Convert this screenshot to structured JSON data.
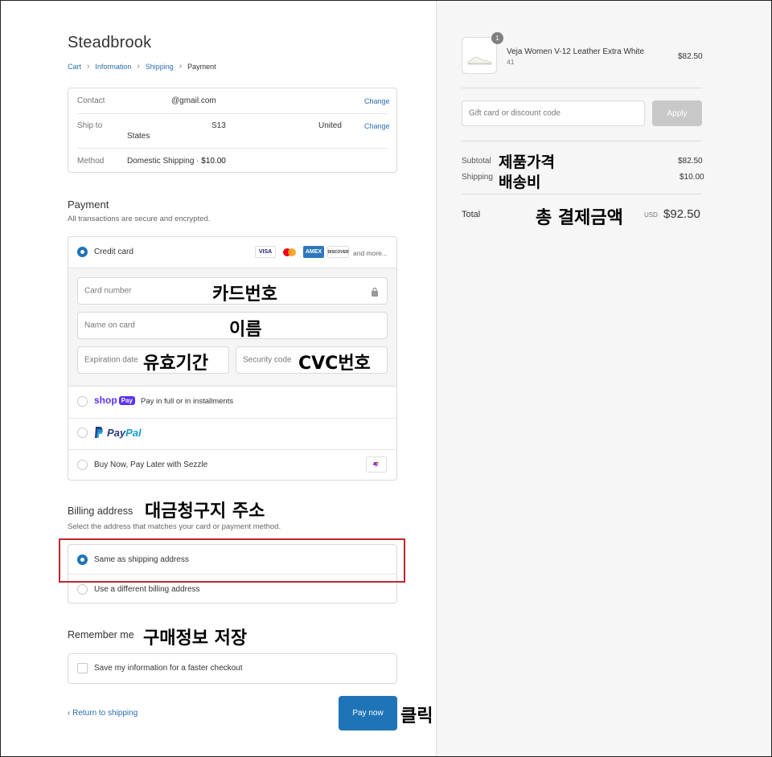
{
  "store_name": "Steadbrook",
  "breadcrumb": [
    "Cart",
    "Information",
    "Shipping",
    "Payment"
  ],
  "summary": {
    "contact_label": "Contact",
    "contact_value": "@gmail.com",
    "ship_label": "Ship to",
    "ship_value_a": "S13",
    "ship_value_b": "United",
    "ship_value_c": "States",
    "method_label": "Method",
    "method_value": "Domestic Shipping · ",
    "method_price": "$10.00",
    "change": "Change"
  },
  "payment": {
    "title": "Payment",
    "subtitle": "All transactions are secure and encrypted.",
    "credit_card": "Credit card",
    "brands": [
      "VISA",
      "AMEX",
      "DISCOVER"
    ],
    "and_more": "and more...",
    "card_number_ph": "Card number",
    "name_on_card_ph": "Name on card",
    "expiry_ph": "Expiration date",
    "security_ph": "Security code",
    "shop_pay_logo_a": "shop",
    "shop_pay_logo_b": "Pay",
    "shop_pay_text": "Pay in full or in installments",
    "paypal_a": "Pay",
    "paypal_b": "Pal",
    "sezzle": "Buy Now, Pay Later with Sezzle"
  },
  "billing": {
    "title": "Billing address",
    "subtitle": "Select the address that matches your card or payment method.",
    "same": "Same as shipping address",
    "different": "Use a different billing address"
  },
  "remember": {
    "title": "Remember me",
    "save": "Save my information for a faster checkout"
  },
  "footer": {
    "return": "Return to shipping",
    "pay_now": "Pay now"
  },
  "order": {
    "qty_badge": "1",
    "product_name": "Veja Women V-12 Leather Extra White",
    "product_variant": "41",
    "product_price": "$82.50",
    "discount_ph": "Gift card or discount code",
    "apply": "Apply",
    "subtotal_label": "Subtotal",
    "subtotal_value": "$82.50",
    "shipping_label": "Shipping",
    "shipping_value": "$10.00",
    "total_label": "Total",
    "total_currency": "USD",
    "total_value": "$92.50"
  },
  "annotations": {
    "card_number": "카드번호",
    "name": "이름",
    "expiry": "유효기간",
    "cvc": "CVC번호",
    "billing": "대금청구지 주소",
    "remember": "구매정보 저장",
    "click": "클릭",
    "product_price": "제품가격",
    "shipping_fee": "배송비",
    "total_amount": "총 결제금액"
  },
  "colors": {
    "accent": "#1f74b7",
    "link": "#2a6db0",
    "highlight_box": "#c0272d",
    "shop_pay": "#5a31f4",
    "paypal_dark": "#253b80",
    "paypal_light": "#179bd7"
  }
}
